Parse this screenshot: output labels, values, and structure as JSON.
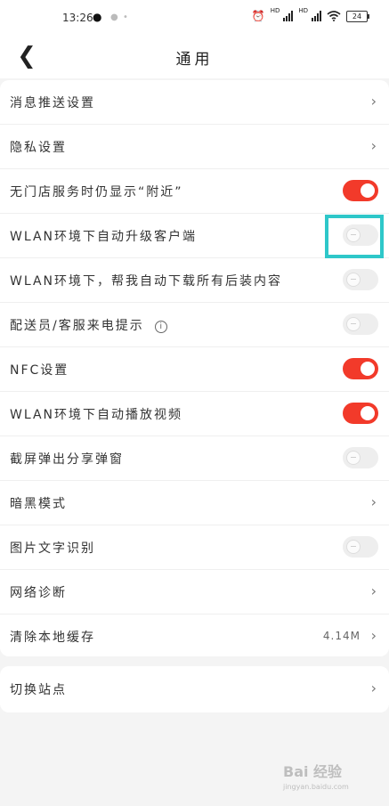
{
  "status_bar": {
    "time": "13:26",
    "battery": "24",
    "icons": [
      "qq-penguin-icon",
      "alarm-icon",
      "hd-signal-icon",
      "hd-signal-icon",
      "wifi-icon",
      "battery-icon"
    ]
  },
  "header": {
    "title": "通用",
    "back_icon": "back-chevron-icon"
  },
  "settings": [
    {
      "label": "消息推送设置",
      "control": "arrow"
    },
    {
      "label": "隐私设置",
      "control": "arrow"
    },
    {
      "label": "无门店服务时仍显示“附近”",
      "control": "toggle",
      "on": true
    },
    {
      "label": "WLAN环境下自动升级客户端",
      "control": "toggle",
      "on": false
    },
    {
      "label": "WLAN环境下，帮我自动下载所有后装内容",
      "control": "toggle",
      "on": false
    },
    {
      "label": "配送员/客服来电提示",
      "control": "toggle",
      "on": false,
      "info_icon": "ⓘ"
    },
    {
      "label": "NFC设置",
      "control": "toggle",
      "on": true
    },
    {
      "label": "WLAN环境下自动播放视频",
      "control": "toggle",
      "on": true
    },
    {
      "label": "截屏弹出分享弹窗",
      "control": "toggle",
      "on": false
    },
    {
      "label": "暗黑模式",
      "control": "arrow"
    },
    {
      "label": "图片文字识别",
      "control": "toggle",
      "on": false
    },
    {
      "label": "网络诊断",
      "control": "arrow"
    },
    {
      "label": "清除本地缓存",
      "control": "arrow",
      "value": "4.14M"
    }
  ],
  "site": {
    "label": "切换站点"
  },
  "colors": {
    "toggle_on": "#f23a2a",
    "toggle_off": "#eeeeee",
    "highlight": "#2ec7c9"
  },
  "watermark": {
    "brand": "Bai 经验",
    "sub": "jingyan.baidu.com"
  }
}
